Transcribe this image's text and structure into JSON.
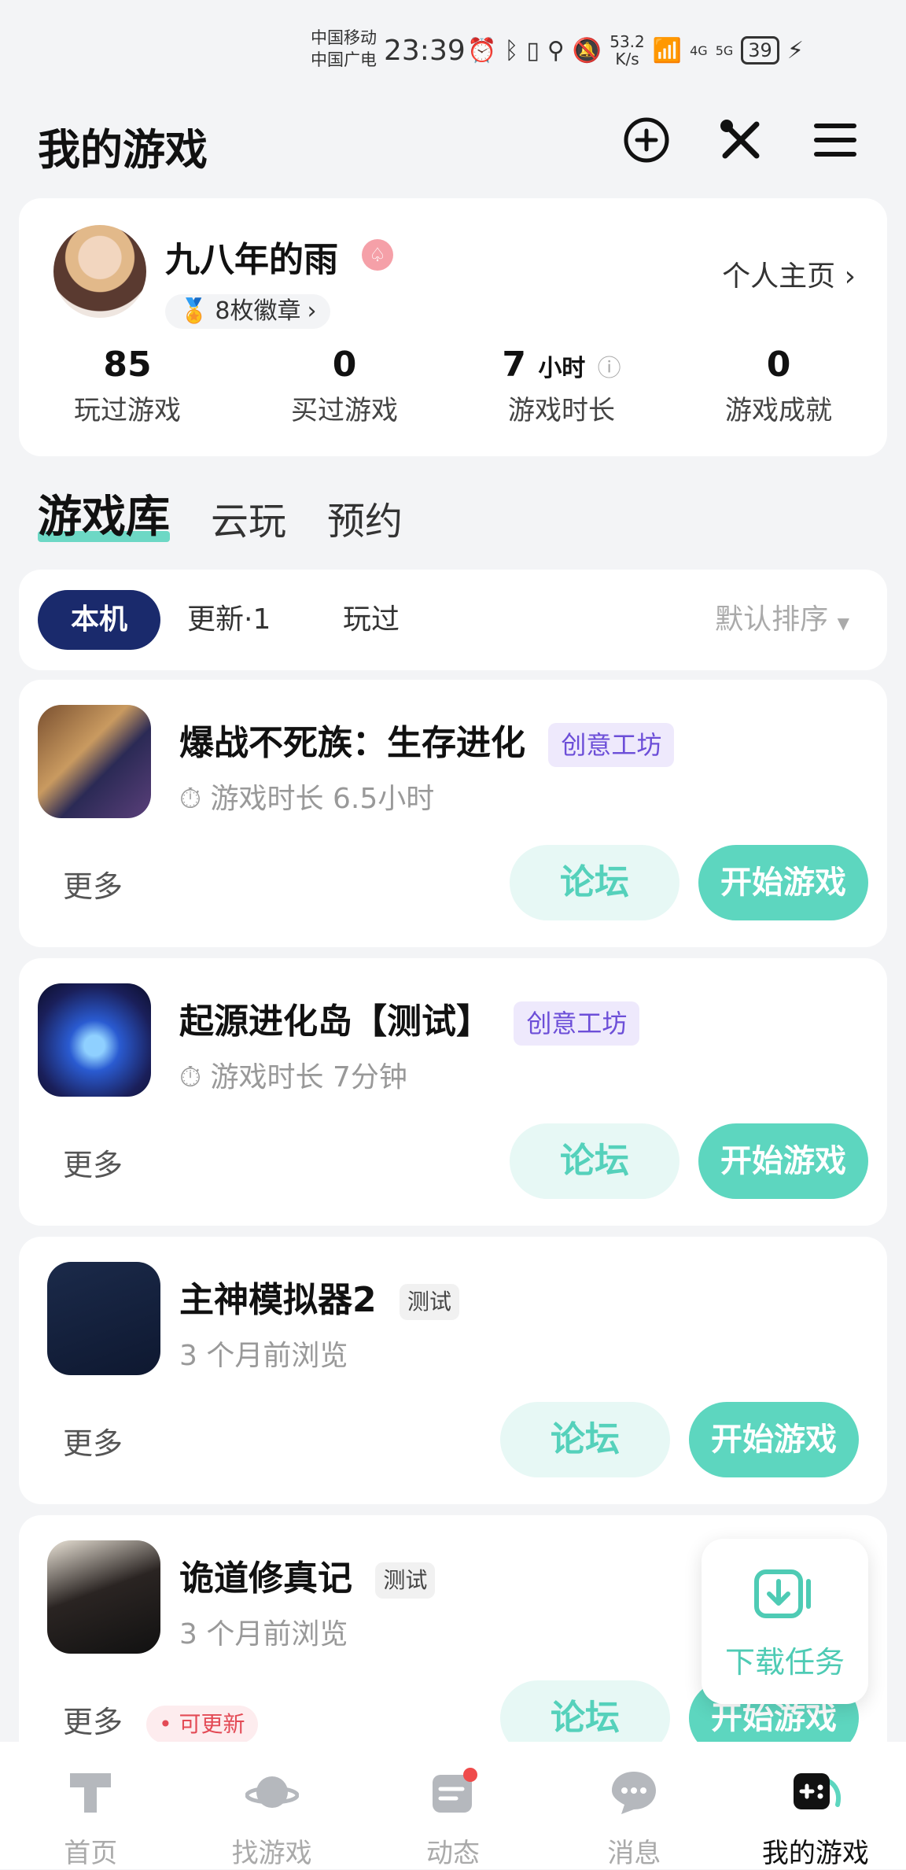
{
  "status_bar": {
    "carrier1": "中国移动",
    "carrier2": "中国广电",
    "time": "23:39",
    "speed_value": "53.2",
    "speed_unit": "K/s",
    "net1": "4G",
    "net2": "5G",
    "battery": "39"
  },
  "header": {
    "title": "我的游戏"
  },
  "profile": {
    "name": "九八年的雨",
    "vip_glyph": "♤",
    "badges": "8枚徽章",
    "homepage_label": "个人主页",
    "stats": [
      {
        "value": "85",
        "unit": "",
        "label": "玩过游戏"
      },
      {
        "value": "0",
        "unit": "",
        "label": "买过游戏"
      },
      {
        "value": "7",
        "unit": "小时",
        "label": "游戏时长"
      },
      {
        "value": "0",
        "unit": "",
        "label": "游戏成就"
      }
    ]
  },
  "tabs": [
    "游戏库",
    "云玩",
    "预约"
  ],
  "filters": {
    "chips": [
      "本机",
      "更新·1",
      "玩过"
    ],
    "sort": "默认排序"
  },
  "games": [
    {
      "name": "爆战不死族：生存进化",
      "tag": "创意工坊",
      "meta": "游戏时长 6.5小时",
      "more": "更多",
      "forum": "论坛",
      "play": "开始游戏"
    },
    {
      "name": "起源进化岛【测试】",
      "tag": "创意工坊",
      "meta": "游戏时长 7分钟",
      "more": "更多",
      "forum": "论坛",
      "play": "开始游戏"
    },
    {
      "name": "主神模拟器2",
      "tag": "测试",
      "meta": "3 个月前浏览",
      "more": "更多",
      "forum": "论坛",
      "play": "开始游戏"
    },
    {
      "name": "诡道修真记",
      "tag": "测试",
      "meta": "3 个月前浏览",
      "more": "更多",
      "update": "可更新",
      "forum": "论坛",
      "play": "开始游戏"
    }
  ],
  "download_task": "下载任务",
  "bottom_nav": [
    "首页",
    "找游戏",
    "动态",
    "消息",
    "我的游戏"
  ],
  "colors": {
    "accent": "#5dd6bf",
    "chip_active": "#1a2a6c",
    "workshop_tag": "#6c4ed8",
    "update_badge": "#e34a55"
  }
}
